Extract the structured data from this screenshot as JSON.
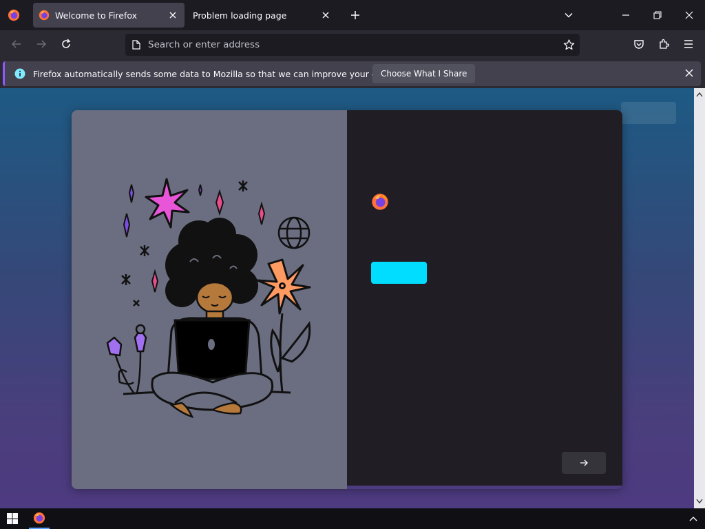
{
  "tabs": [
    {
      "title": "Welcome to Firefox",
      "active": true,
      "icon": "firefox-icon"
    },
    {
      "title": "Problem loading page",
      "active": false,
      "icon": "none"
    }
  ],
  "toolbar": {
    "address_placeholder": "Search or enter address"
  },
  "notification": {
    "message": "Firefox automatically sends some data to Mozilla so that we can improve your experience.",
    "button_label": "Choose What I Share"
  },
  "colors": {
    "accent": "#00ddff",
    "notification_bar_accent": "#9059ff",
    "tab_active_bg": "#42414d",
    "card_right_bg": "#201e24",
    "card_left_bg": "#6b6e80"
  },
  "icons": [
    "firefox-icon",
    "close-icon",
    "plus-icon",
    "chevron-down-icon",
    "minimize-icon",
    "restore-icon",
    "back-arrow-icon",
    "forward-arrow-icon",
    "reload-icon",
    "page-icon",
    "star-icon",
    "pocket-icon",
    "extensions-icon",
    "hamburger-menu-icon",
    "info-icon",
    "arrow-right-icon",
    "windows-start-icon",
    "chevron-up-icon"
  ]
}
